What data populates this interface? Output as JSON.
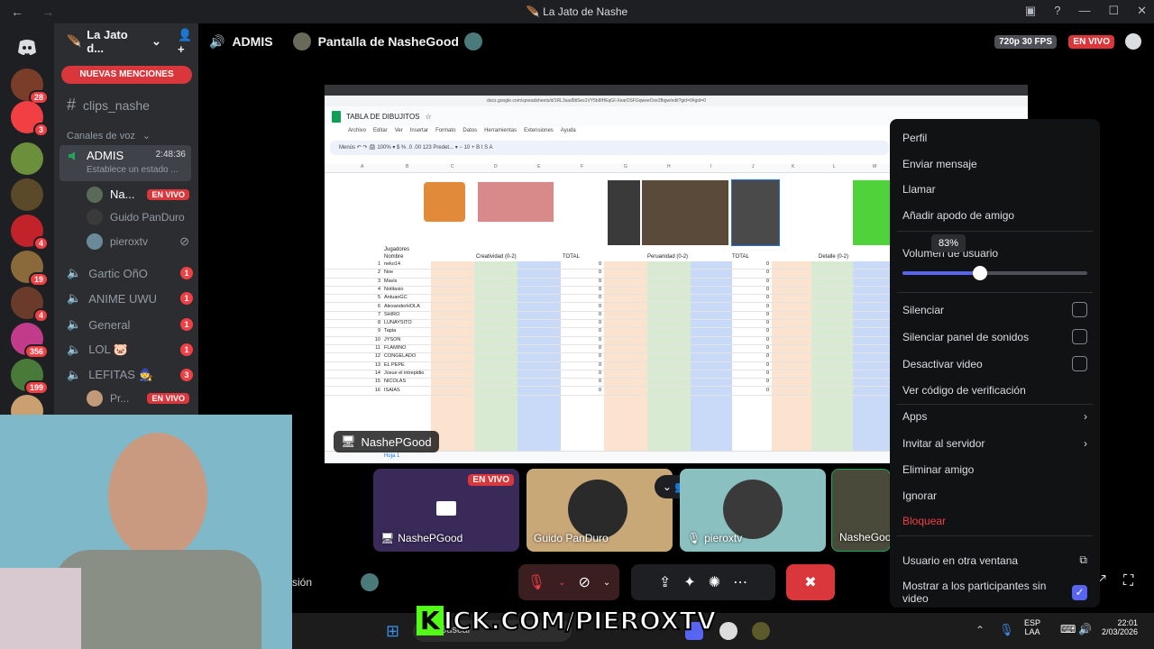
{
  "window": {
    "title": "La Jato de Nashe",
    "back_icon": "←",
    "fwd_icon": "→"
  },
  "guild": {
    "name": "La Jato d...",
    "mention_button": "NUEVAS MENCIONES"
  },
  "rail_badges": [
    "28",
    "3",
    "4",
    "19",
    "4",
    "356",
    "199"
  ],
  "channels": {
    "text": "clips_nashe",
    "voice_header": "Canales de voz",
    "active": {
      "name": "ADMIS",
      "timer": "2:48:36",
      "status": "Establece un estado ..."
    },
    "members": [
      {
        "name": "Na...",
        "live": "EN VIVO"
      },
      {
        "name": "Guido PanDuro"
      },
      {
        "name": "pieroxtv"
      }
    ],
    "voice": [
      {
        "name": "Gartic OñO",
        "badge": "1"
      },
      {
        "name": "ANIME UWU",
        "badge": "1"
      },
      {
        "name": "General",
        "badge": "1"
      },
      {
        "name": "LOL 🐷",
        "badge": "1"
      },
      {
        "name": "LEFITAS 🧙",
        "badge": "3"
      }
    ],
    "lefitas_member": {
      "name": "Pr...",
      "live": "EN VIVO"
    }
  },
  "header": {
    "channel": "ADMIS",
    "stream": "Pantalla de NasheGood",
    "quality": "720p 30 FPS",
    "live": "EN VIVO"
  },
  "sheet": {
    "title": "TABLA DE DIBUJITOS",
    "url": "docs.google.com/spreadsheets/d/1RL3sad9tiSes1VY5b8lHEqGI-XearDSFGqweeOxe2fbgw/edit?gid=0#gid=0",
    "menus": [
      "Archivo",
      "Editar",
      "Ver",
      "Insertar",
      "Formato",
      "Datos",
      "Herramientas",
      "Extensiones",
      "Ayuda"
    ],
    "toolbar": "Menús   ↶ ↷ 🖨 100% ▾  $ % .0 .00 123  Predet... ▾  − 10 +  B I S A",
    "columns": [
      "A",
      "B",
      "C",
      "D",
      "E",
      "F",
      "G",
      "H",
      "I",
      "J",
      "K",
      "L",
      "M"
    ],
    "header_row": [
      "Jugadores"
    ],
    "col_labels": [
      "Nombre",
      "Creatividad (0-2)",
      "TOTAL",
      "Peruanidad (0-2)",
      "TOTAL",
      "Detalle (0-2)"
    ],
    "players": [
      "neko14",
      "Noe",
      "Mavis",
      "Notitasio",
      "AntuanGC",
      "AlexanderHOLA",
      "SHIRO",
      "LUNAYSITO",
      "Tapia",
      "JYSON",
      "FLAMINO",
      "CONGELADO",
      "EL PEPE",
      "Josue el intrepidio",
      "NICOLAS",
      "ISAIAS"
    ],
    "zero": "0",
    "tab": "Hoja 1"
  },
  "share_nametag": "NashePGood",
  "tiles": [
    {
      "name": "NashePGood",
      "live": "EN VIVO"
    },
    {
      "name": "Guido PanDuro"
    },
    {
      "name": "pieroxtv"
    },
    {
      "name": "NasheGoo..."
    }
  ],
  "context_menu": {
    "profile": "Perfil",
    "message": "Enviar mensaje",
    "call": "Llamar",
    "nickname": "Añadir apodo de amigo",
    "volume_label": "Volumen de usuario",
    "volume_tooltip": "83%",
    "volume": 0.42,
    "mute": "Silenciar",
    "mute_sounds": "Silenciar panel de sonidos",
    "disable_video": "Desactivar video",
    "verify": "Ver código de verificación",
    "apps": "Apps",
    "invite": "Invitar al servidor",
    "remove": "Eliminar amigo",
    "ignore": "Ignorar",
    "block": "Bloquear",
    "popout": "Usuario en otra ventana",
    "show_nonvideo": "Mostrar a los participantes sin video"
  },
  "left_label": "sión",
  "taskbar": {
    "search": "Buscar",
    "lang1": "ESP",
    "lang2": "LAA",
    "time": "22:01",
    "date": "2/03/2026"
  },
  "watermark": "KICK.COM/PIEROXTV",
  "colors": {
    "accent": "#5865f2",
    "danger": "#da373c",
    "block": "#f23f43",
    "kick": "#53fc18"
  }
}
